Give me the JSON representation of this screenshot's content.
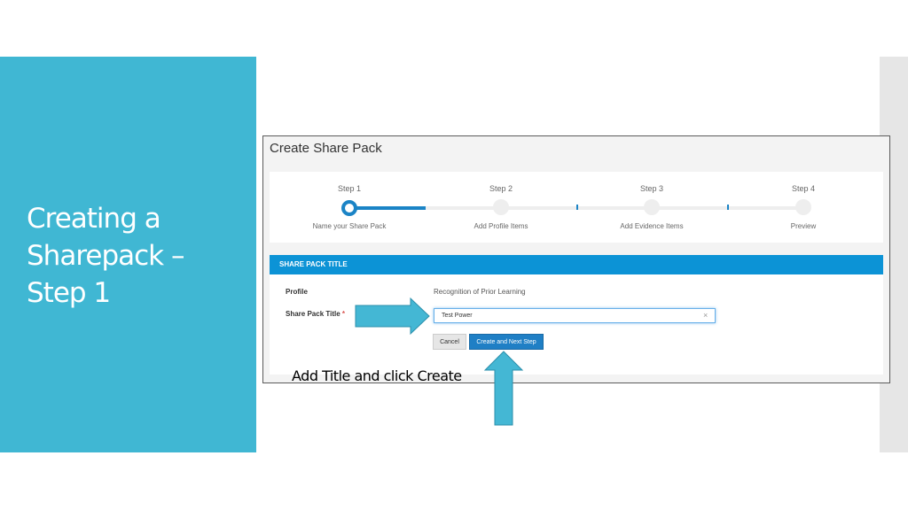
{
  "slide": {
    "title_lines": [
      "Creating a",
      "Sharepack –",
      "Step 1"
    ],
    "caption": "Add Title and click Create"
  },
  "screenshot": {
    "header": "Create Share Pack",
    "steps": [
      {
        "label": "Step 1",
        "sublabel": "Name your Share Pack",
        "state": "active"
      },
      {
        "label": "Step 2",
        "sublabel": "Add Profile Items",
        "state": "inactive"
      },
      {
        "label": "Step 3",
        "sublabel": "Add Evidence Items",
        "state": "inactive"
      },
      {
        "label": "Step 4",
        "sublabel": "Preview",
        "state": "inactive"
      }
    ],
    "panel": {
      "heading": "SHARE PACK TITLE",
      "profile_label": "Profile",
      "profile_value": "Recognition of Prior Learning",
      "title_label": "Share Pack Title",
      "required_mark": "*",
      "title_value": "Test Power",
      "clear_glyph": "×",
      "cancel_label": "Cancel",
      "create_label": "Create and Next Step"
    }
  },
  "colors": {
    "side_panel": "#40b7d3",
    "primary_blue": "#1b84c6",
    "panel_heading": "#0c93d6",
    "arrow_fill": "#44b7d4"
  },
  "icons": {
    "clear": "close-icon",
    "arrow_right": "arrow-right-icon",
    "arrow_up": "arrow-up-icon"
  }
}
